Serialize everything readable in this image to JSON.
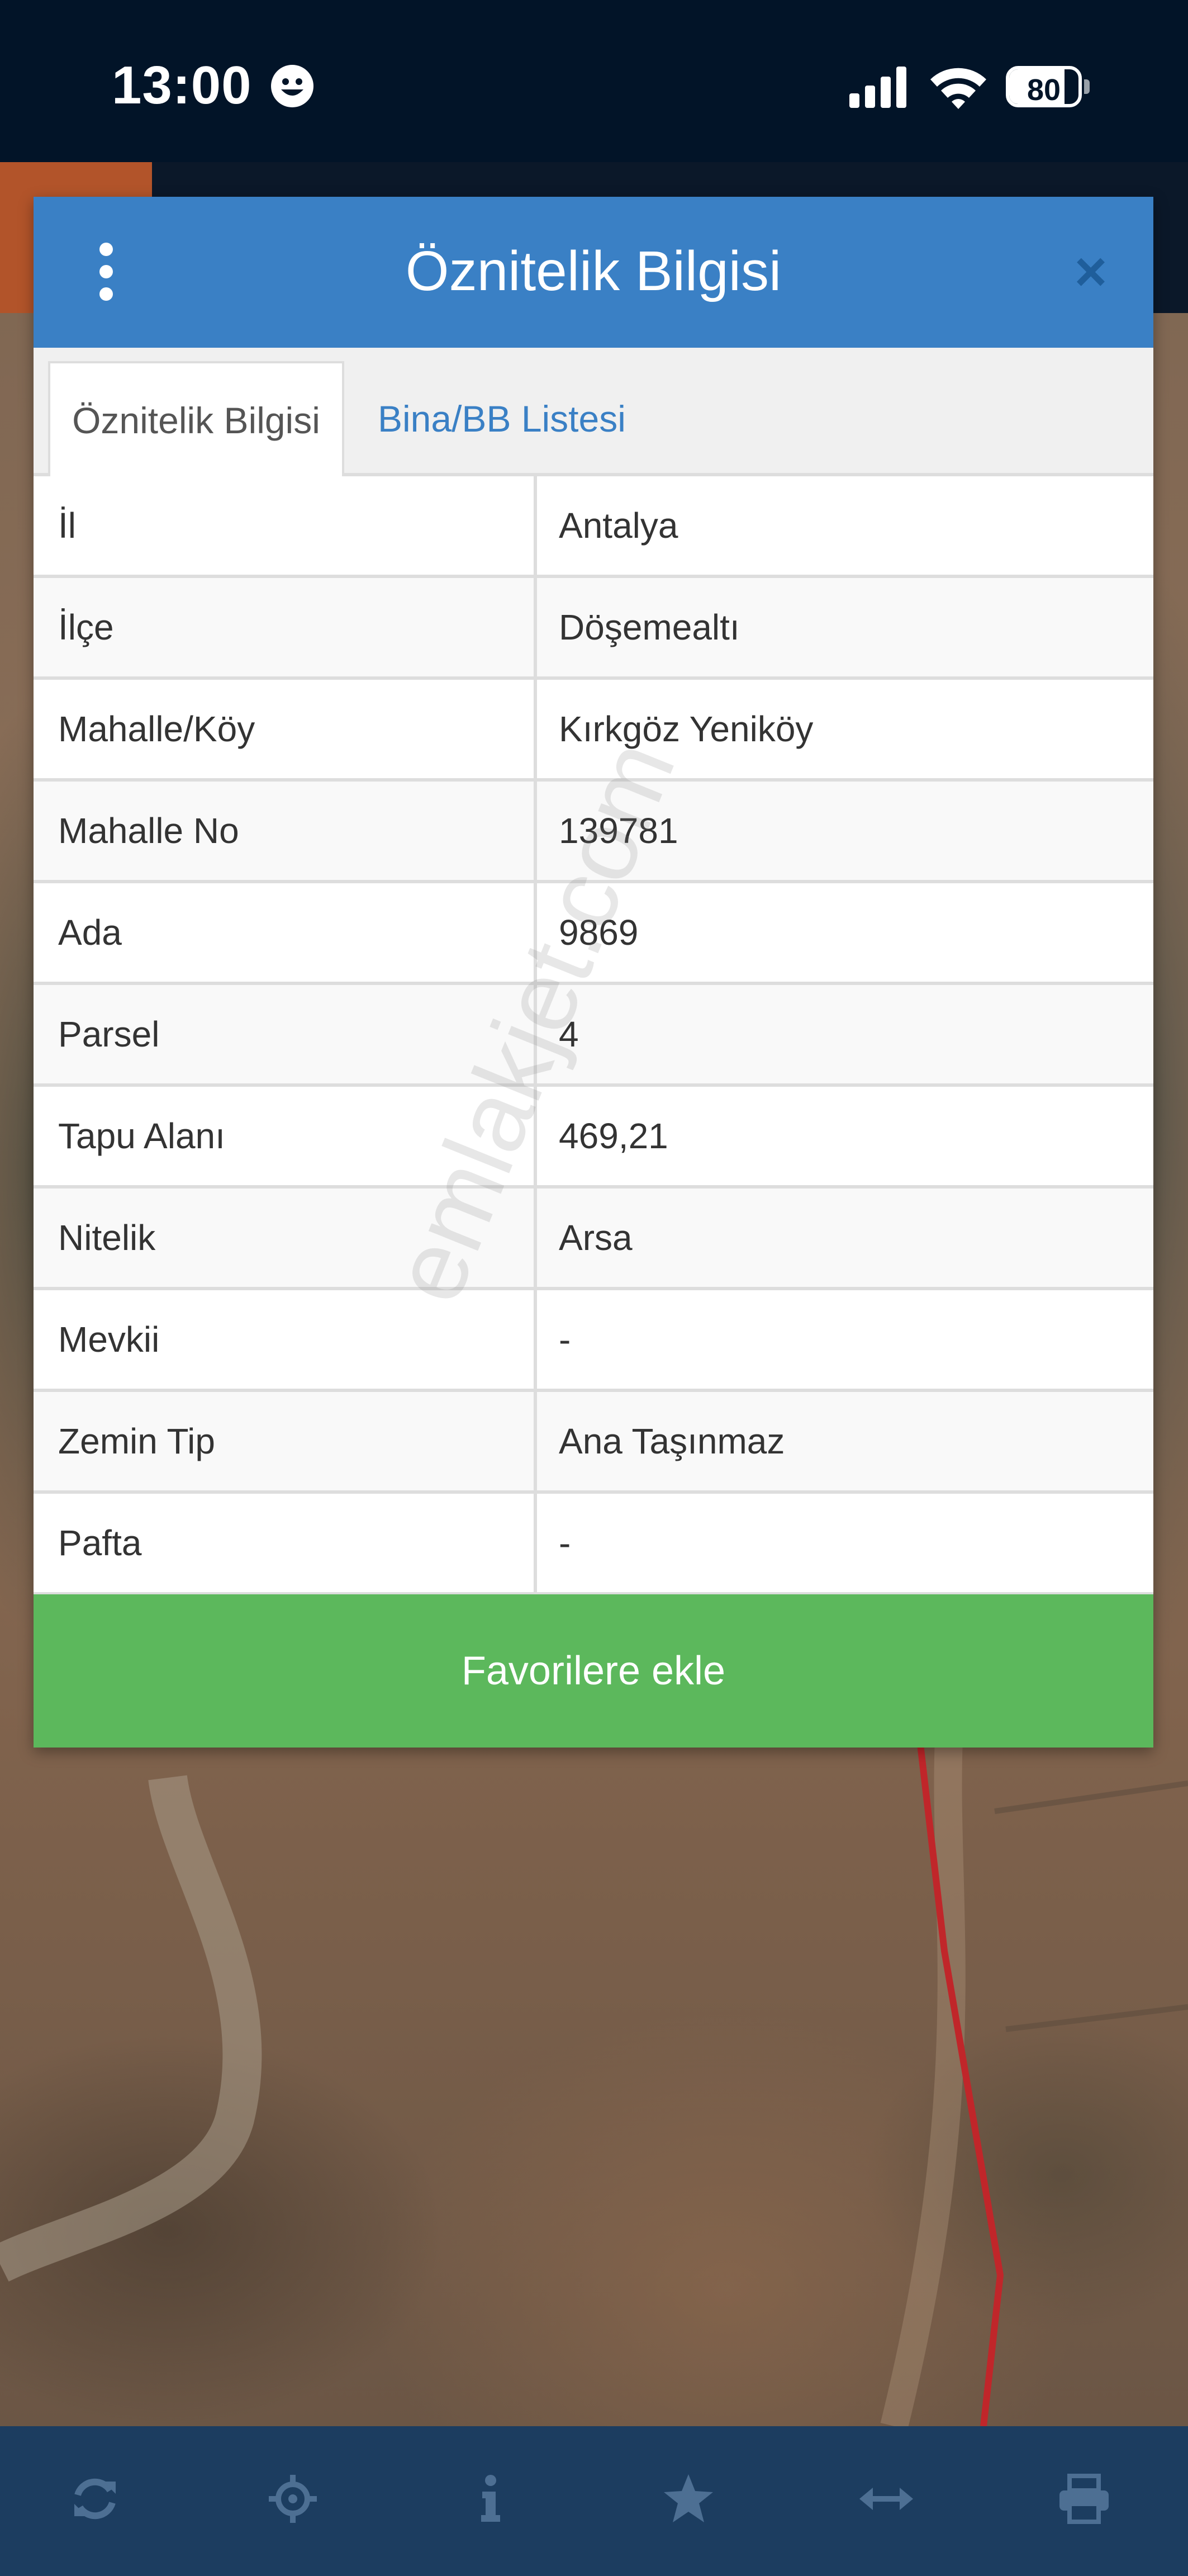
{
  "status_bar": {
    "time": "13:00",
    "battery_level": "80",
    "battery_fraction": 0.8
  },
  "dialog": {
    "title": "Öznitelik Bilgisi",
    "close_glyph": "×",
    "tabs": [
      {
        "label": "Öznitelik Bilgisi",
        "active": true
      },
      {
        "label": "Bina/BB Listesi",
        "active": false
      }
    ],
    "rows": [
      {
        "label": "İl",
        "value": "Antalya"
      },
      {
        "label": "İlçe",
        "value": "Döşemealtı"
      },
      {
        "label": "Mahalle/Köy",
        "value": "Kırkgöz Yeniköy"
      },
      {
        "label": "Mahalle No",
        "value": "139781"
      },
      {
        "label": "Ada",
        "value": "9869"
      },
      {
        "label": "Parsel",
        "value": "4"
      },
      {
        "label": "Tapu Alanı",
        "value": "469,21"
      },
      {
        "label": "Nitelik",
        "value": "Arsa"
      },
      {
        "label": "Mevkii",
        "value": "-"
      },
      {
        "label": "Zemin Tip",
        "value": "Ana Taşınmaz"
      },
      {
        "label": "Pafta",
        "value": "-"
      }
    ],
    "favorite_label": "Favorilere ekle"
  },
  "watermark": "emlakjet.com",
  "toolbar": {
    "items": [
      {
        "icon": "refresh-icon"
      },
      {
        "icon": "crosshair-icon"
      },
      {
        "icon": "info-icon"
      },
      {
        "icon": "star-icon"
      },
      {
        "icon": "measure-icon"
      },
      {
        "icon": "print-icon"
      }
    ]
  },
  "colors": {
    "header": "#3a80c5",
    "favorite": "#5cb85c",
    "toolbar": "#1c3d60",
    "status_bar": "#021428",
    "parcel_line": "#c0262a"
  }
}
